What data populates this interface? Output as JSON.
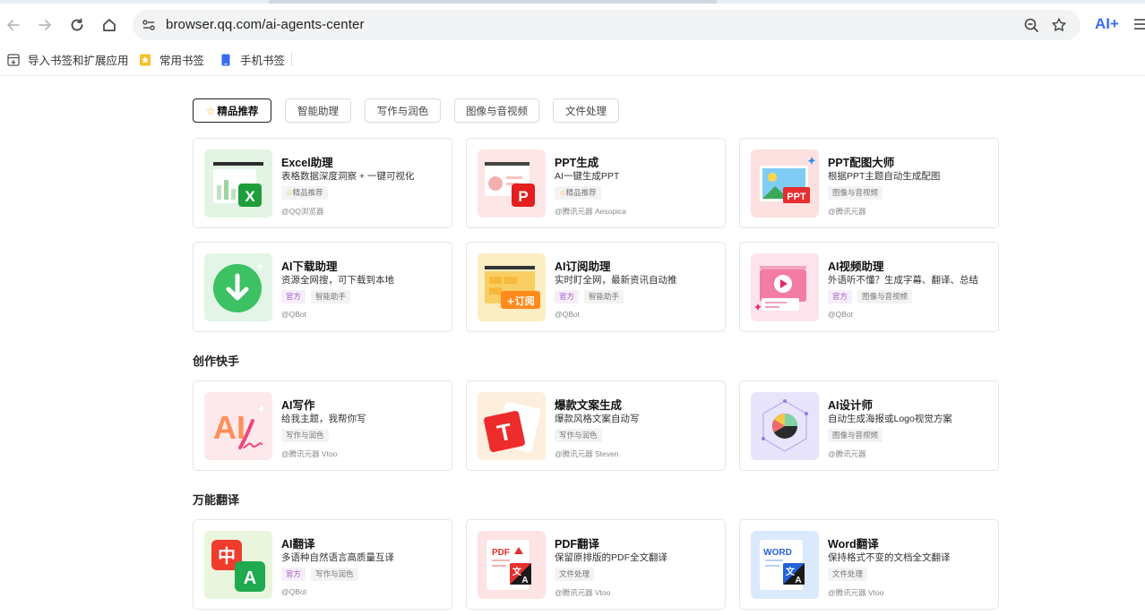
{
  "browser": {
    "url": "browser.qq.com/ai-agents-center",
    "ai_label": "AI+",
    "bookmarks": [
      {
        "label": "导入书签和扩展应用",
        "icon": "import-bookmark-icon"
      },
      {
        "label": "常用书签",
        "icon": "star-bookmark-icon"
      },
      {
        "label": "手机书签",
        "icon": "phone-bookmark-icon"
      }
    ]
  },
  "tabs": [
    {
      "label": "精品推荐",
      "active": true,
      "icon": "star-icon"
    },
    {
      "label": "智能助理",
      "active": false
    },
    {
      "label": "写作与润色",
      "active": false
    },
    {
      "label": "图像与音视频",
      "active": false
    },
    {
      "label": "文件处理",
      "active": false
    }
  ],
  "sections": [
    {
      "title": ""
    },
    {
      "title": "创作快手"
    },
    {
      "title": "万能翻译"
    }
  ],
  "cards": [
    {
      "title": "Excel助理",
      "desc": "表格数据深度洞察 + 一键可视化",
      "tags": [
        "精品推荐"
      ],
      "tag_star": true,
      "author": "@QQ浏览器",
      "icon": "excel-icon"
    },
    {
      "title": "PPT生成",
      "desc": "AI一键生成PPT",
      "tags": [
        "精品推荐"
      ],
      "tag_star": true,
      "author": "@腾讯元器 Aesopica",
      "icon": "ppt-icon"
    },
    {
      "title": "PPT配图大师",
      "desc": "根据PPT主题自动生成配图",
      "tags": [
        "图像与音视频"
      ],
      "tag_star": false,
      "author": "@腾讯元器",
      "icon": "ppt-image-icon"
    },
    {
      "title": "AI下载助理",
      "desc": "资源全网搜，可下载到本地",
      "tags": [
        "官方",
        "智能助手"
      ],
      "tag_star": false,
      "author": "@QBot",
      "icon": "download-icon"
    },
    {
      "title": "AI订阅助理",
      "desc": "实时盯全网，最新资讯自动推",
      "tags": [
        "官方",
        "智能助手"
      ],
      "tag_star": false,
      "author": "@QBot",
      "icon": "subscribe-icon",
      "badge": "+订阅"
    },
    {
      "title": "AI视频助理",
      "desc": "外语听不懂？生成字幕、翻译、总结",
      "tags": [
        "官方",
        "图像与音视频"
      ],
      "tag_star": false,
      "author": "@QBot",
      "icon": "video-icon"
    },
    {
      "title": "AI写作",
      "desc": "给我主题，我帮你写",
      "tags": [
        "写作与润色"
      ],
      "tag_star": false,
      "author": "@腾讯元器 Vtoo",
      "icon": "writing-icon"
    },
    {
      "title": "爆款文案生成",
      "desc": "爆款风格文案自动写",
      "tags": [
        "写作与润色"
      ],
      "tag_star": false,
      "author": "@腾讯元器 Steven",
      "icon": "copywriting-icon"
    },
    {
      "title": "AI设计师",
      "desc": "自动生成海报或Logo视觉方案",
      "tags": [
        "图像与音视频"
      ],
      "tag_star": false,
      "author": "@腾讯元器",
      "icon": "designer-icon"
    },
    {
      "title": "AI翻译",
      "desc": "多语种自然语言高质量互译",
      "tags": [
        "官方",
        "写作与润色"
      ],
      "tag_star": false,
      "author": "@QBot",
      "icon": "translate-icon"
    },
    {
      "title": "PDF翻译",
      "desc": "保留原排版的PDF全文翻译",
      "tags": [
        "文件处理"
      ],
      "tag_star": false,
      "author": "@腾讯元器 Vtoo",
      "icon": "pdf-translate-icon"
    },
    {
      "title": "Word翻译",
      "desc": "保持格式不变的文档全文翻译",
      "tags": [
        "文件处理"
      ],
      "tag_star": false,
      "author": "@腾讯元器 Vtoo",
      "icon": "word-translate-icon"
    }
  ],
  "thumb_text": {
    "ppt": "P",
    "excel": "X",
    "ppt_badge": "PPT",
    "subscribe_badge": "+订阅",
    "writing": "AI",
    "copy": "T",
    "zh": "中",
    "a": "A",
    "pdf": "PDF",
    "word": "WORD",
    "wen": "文"
  },
  "colors": {
    "accent": "#3a6df0",
    "star": "#f2b400",
    "official_tag": "#a05ec4"
  }
}
